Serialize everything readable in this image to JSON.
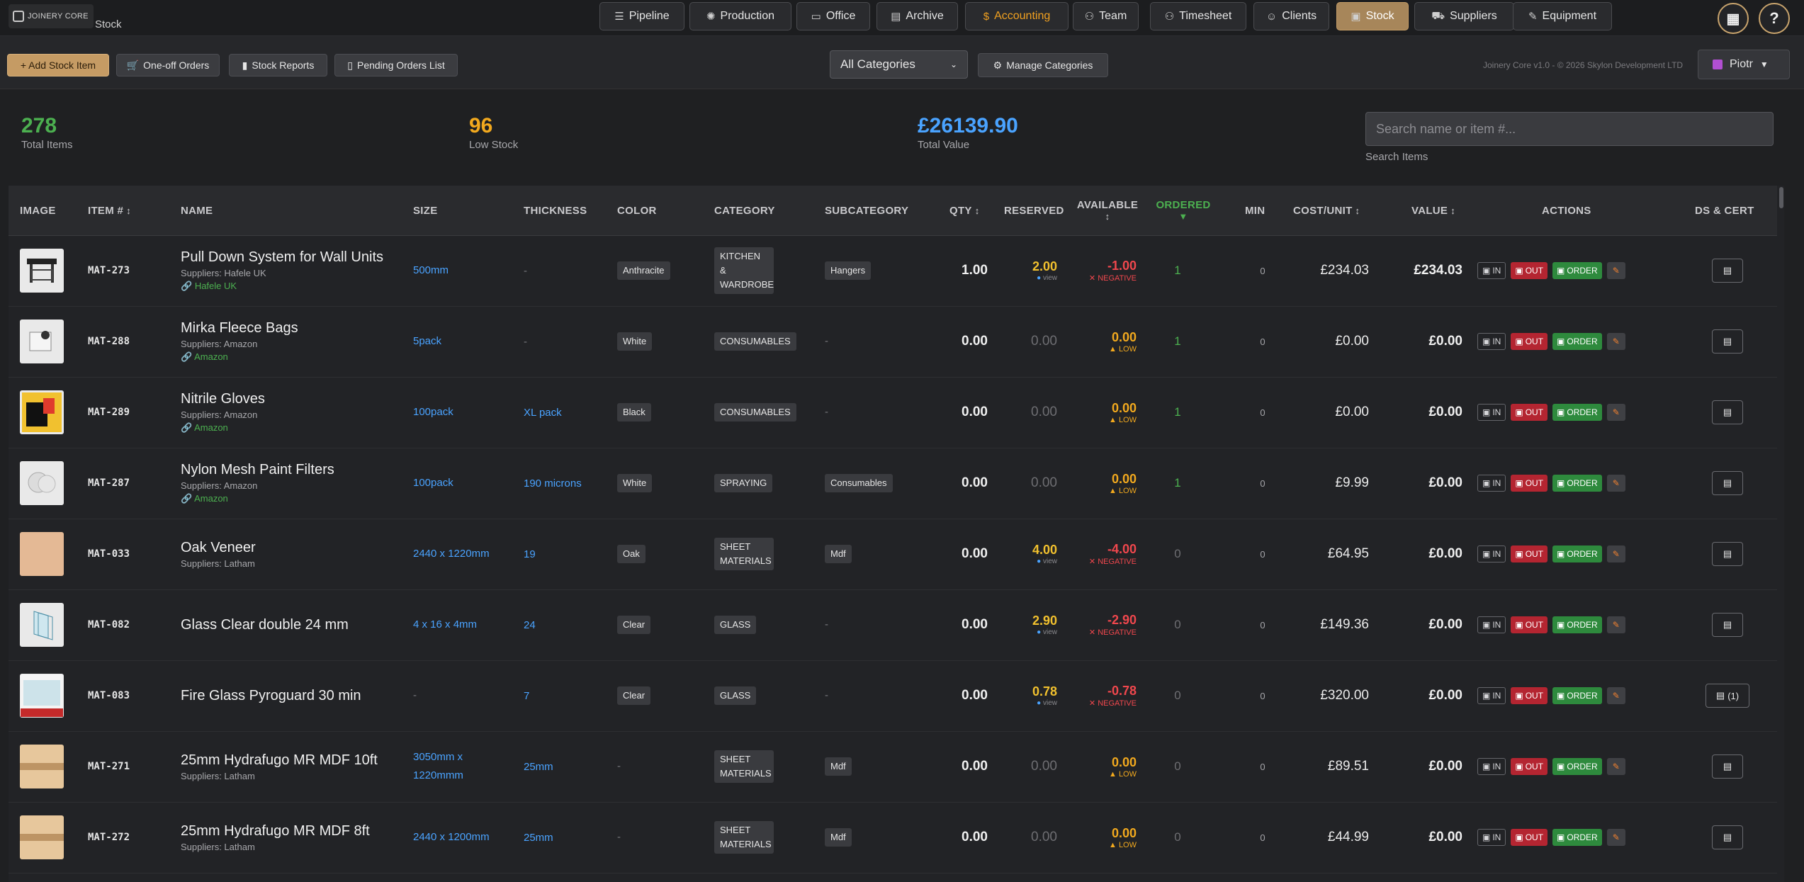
{
  "app": {
    "logo_text": "JOINERY CORE",
    "section": "Stock"
  },
  "nav": [
    {
      "label": "Pipeline",
      "icon": "list-icon"
    },
    {
      "label": "Production",
      "icon": "gear-icon"
    },
    {
      "label": "Office",
      "icon": "folder-icon"
    },
    {
      "label": "Archive",
      "icon": "archive-icon"
    },
    {
      "label": "Accounting",
      "icon": "dollar-icon"
    },
    {
      "label": "Team",
      "icon": "team-icon"
    },
    {
      "label": "Timesheet",
      "icon": "people-icon"
    },
    {
      "label": "Clients",
      "icon": "person-icon"
    },
    {
      "label": "Stock",
      "icon": "box-icon",
      "active": true
    },
    {
      "label": "Suppliers",
      "icon": "truck-icon"
    },
    {
      "label": "Equipment",
      "icon": "wrench-icon"
    }
  ],
  "toolbar": {
    "add_label": "+ Add Stock Item",
    "oneoff_label": "One-off Orders",
    "reports_label": "Stock Reports",
    "pending_label": "Pending Orders List",
    "category_value": "All Categories",
    "manage_label": "Manage Categories",
    "version": "Joinery Core v1.0 - © 2026 Skylon Development LTD",
    "user": "Piotr"
  },
  "stats": {
    "total_items": "278",
    "total_items_label": "Total Items",
    "low_stock": "96",
    "low_stock_label": "Low Stock",
    "total_value": "£26139.90",
    "total_value_label": "Total Value"
  },
  "search": {
    "placeholder": "Search name or item #...",
    "label": "Search Items"
  },
  "colors": {
    "accent": "#c59b64",
    "green": "#4cb050",
    "red": "#f0474d",
    "orange": "#f2a91e",
    "blue": "#4aa3ff"
  },
  "table": {
    "headers": {
      "image": "IMAGE",
      "item": "ITEM #",
      "name": "NAME",
      "size": "SIZE",
      "thickness": "THICKNESS",
      "color": "COLOR",
      "category": "CATEGORY",
      "subcategory": "SUBCATEGORY",
      "qty": "QTY",
      "reserved": "RESERVED",
      "available": "AVAILABLE",
      "ordered": "ORDERED",
      "min": "MIN",
      "cost": "COST/UNIT",
      "value": "VALUE",
      "actions": "ACTIONS",
      "ds": "DS & CERT"
    },
    "action_labels": {
      "in": "IN",
      "out": "OUT",
      "order": "ORDER"
    },
    "view_label": "view",
    "rows": [
      {
        "item": "MAT-273",
        "name": "Pull Down System for Wall Units",
        "supplier": "Suppliers: Hafele UK",
        "link": "Hafele UK",
        "size": "500mm",
        "thickness": "-",
        "color": "Anthracite",
        "category": "KITCHEN & WARDROBE",
        "subcategory": "Hangers",
        "qty": "1.00",
        "reserved": "2.00",
        "available": "-1.00",
        "avail_status": "NEGATIVE",
        "ordered": "1",
        "min": "0",
        "cost": "£234.03",
        "value": "£234.03",
        "thumb": "mechanism",
        "ds": ""
      },
      {
        "item": "MAT-288",
        "name": "Mirka Fleece Bags",
        "supplier": "Suppliers: Amazon",
        "link": "Amazon",
        "size": "5pack",
        "thickness": "-",
        "color": "White",
        "category": "CONSUMABLES",
        "subcategory": "-",
        "qty": "0.00",
        "reserved": "0.00",
        "available": "0.00",
        "avail_status": "LOW",
        "ordered": "1",
        "min": "0",
        "cost": "£0.00",
        "value": "£0.00",
        "thumb": "bag",
        "ds": ""
      },
      {
        "item": "MAT-289",
        "name": "Nitrile Gloves",
        "supplier": "Suppliers: Amazon",
        "link": "Amazon",
        "size": "100pack",
        "thickness": "XL pack",
        "color": "Black",
        "category": "CONSUMABLES",
        "subcategory": "-",
        "qty": "0.00",
        "reserved": "0.00",
        "available": "0.00",
        "avail_status": "LOW",
        "ordered": "1",
        "min": "0",
        "cost": "£0.00",
        "value": "£0.00",
        "thumb": "gloves",
        "ds": ""
      },
      {
        "item": "MAT-287",
        "name": "Nylon Mesh Paint Filters",
        "supplier": "Suppliers: Amazon",
        "link": "Amazon",
        "size": "100pack",
        "thickness": "190 microns",
        "color": "White",
        "category": "SPRAYING",
        "subcategory": "Consumables",
        "qty": "0.00",
        "reserved": "0.00",
        "available": "0.00",
        "avail_status": "LOW",
        "ordered": "1",
        "min": "0",
        "cost": "£9.99",
        "value": "£0.00",
        "thumb": "filters",
        "ds": ""
      },
      {
        "item": "MAT-033",
        "name": "Oak Veneer",
        "supplier": "Suppliers: Latham",
        "link": "",
        "size": "2440 x 1220mm",
        "thickness": "19",
        "color": "Oak",
        "category": "SHEET MATERIALS",
        "subcategory": "Mdf",
        "qty": "0.00",
        "reserved": "4.00",
        "available": "-4.00",
        "avail_status": "NEGATIVE",
        "ordered": "0",
        "min": "0",
        "cost": "£64.95",
        "value": "£0.00",
        "thumb": "wood",
        "ds": ""
      },
      {
        "item": "MAT-082",
        "name": "Glass Clear double 24 mm",
        "supplier": "",
        "link": "",
        "size": "4 x 16 x 4mm",
        "thickness": "24",
        "color": "Clear",
        "category": "GLASS",
        "subcategory": "-",
        "qty": "0.00",
        "reserved": "2.90",
        "available": "-2.90",
        "avail_status": "NEGATIVE",
        "ordered": "0",
        "min": "0",
        "cost": "£149.36",
        "value": "£0.00",
        "thumb": "glass",
        "ds": ""
      },
      {
        "item": "MAT-083",
        "name": "Fire Glass Pyroguard 30 min",
        "supplier": "",
        "link": "",
        "size": "-",
        "thickness": "7",
        "color": "Clear",
        "category": "GLASS",
        "subcategory": "-",
        "qty": "0.00",
        "reserved": "0.78",
        "available": "-0.78",
        "avail_status": "NEGATIVE",
        "ordered": "0",
        "min": "0",
        "cost": "£320.00",
        "value": "£0.00",
        "thumb": "fireglass",
        "ds": "(1)"
      },
      {
        "item": "MAT-271",
        "name": "25mm Hydrafugo MR MDF 10ft",
        "supplier": "Suppliers: Latham",
        "link": "",
        "size": "3050mm x 1220mmm",
        "thickness": "25mm",
        "color": "-",
        "category": "SHEET MATERIALS",
        "subcategory": "Mdf",
        "qty": "0.00",
        "reserved": "0.00",
        "available": "0.00",
        "avail_status": "LOW",
        "ordered": "0",
        "min": "0",
        "cost": "£89.51",
        "value": "£0.00",
        "thumb": "mdf",
        "ds": ""
      },
      {
        "item": "MAT-272",
        "name": "25mm Hydrafugo MR MDF 8ft",
        "supplier": "Suppliers: Latham",
        "link": "",
        "size": "2440 x 1200mm",
        "thickness": "25mm",
        "color": "-",
        "category": "SHEET MATERIALS",
        "subcategory": "Mdf",
        "qty": "0.00",
        "reserved": "0.00",
        "available": "0.00",
        "avail_status": "LOW",
        "ordered": "0",
        "min": "0",
        "cost": "£44.99",
        "value": "£0.00",
        "thumb": "mdf",
        "ds": ""
      }
    ]
  }
}
